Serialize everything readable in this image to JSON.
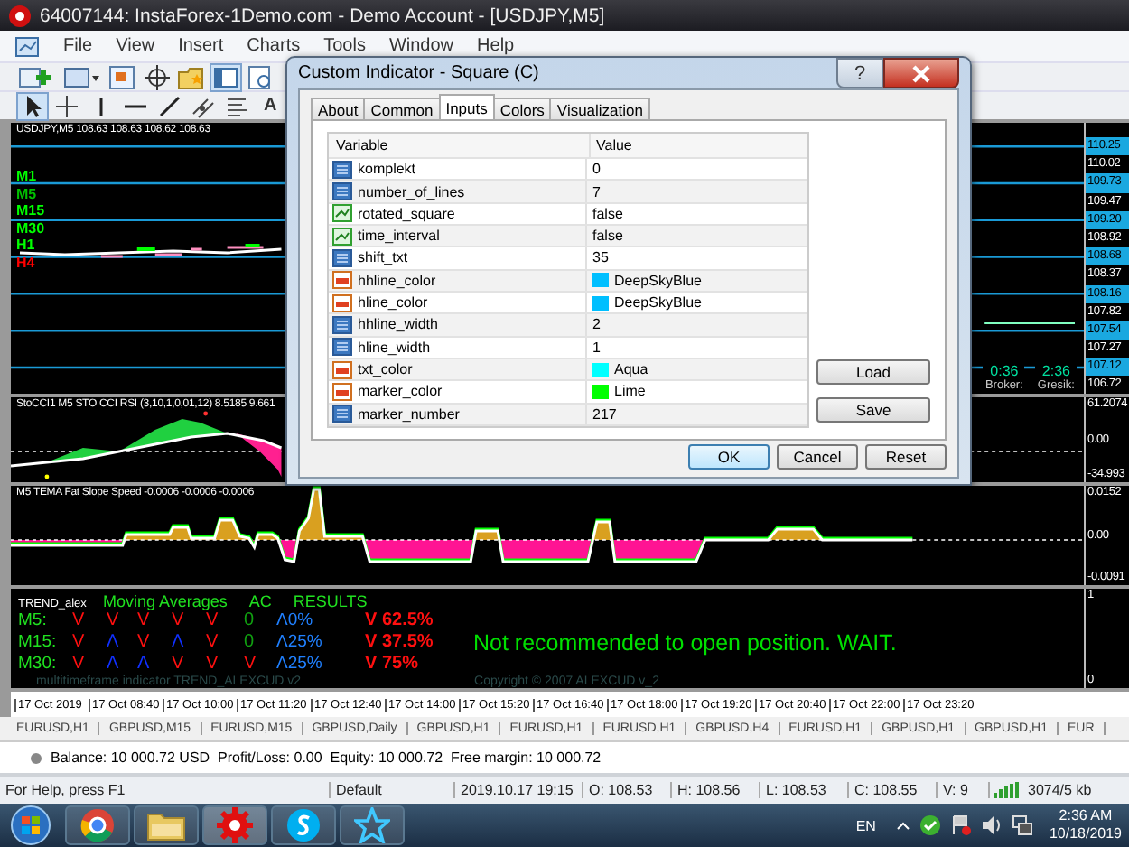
{
  "window": {
    "title": "64007144: InstaForex-1Demo.com - Demo Account - [USDJPY,M5]"
  },
  "menu": [
    "File",
    "View",
    "Insert",
    "Charts",
    "Tools",
    "Window",
    "Help"
  ],
  "drawing_tools": {
    "text_tool": "A"
  },
  "main_chart": {
    "header": "USDJPY,M5  108.63 108.63 108.62 108.63",
    "timeframes": [
      {
        "label": "M1",
        "color": "#00ff00"
      },
      {
        "label": "M5",
        "color": "#00c000"
      },
      {
        "label": "M15",
        "color": "#00ff00"
      },
      {
        "label": "M30",
        "color": "#00ff00"
      },
      {
        "label": "H1",
        "color": "#00ff00"
      },
      {
        "label": "H4",
        "color": "#ff0000"
      }
    ],
    "price_labels": [
      {
        "text": "110.25",
        "highlighted": true
      },
      {
        "text": "110.02",
        "highlighted": false
      },
      {
        "text": "109.73",
        "highlighted": true
      },
      {
        "text": "109.47",
        "highlighted": false
      },
      {
        "text": "109.20",
        "highlighted": true
      },
      {
        "text": "108.92",
        "highlighted": false
      },
      {
        "text": "108.68",
        "highlighted": true
      },
      {
        "text": "108.37",
        "highlighted": false
      },
      {
        "text": "108.16",
        "highlighted": true
      },
      {
        "text": "107.82",
        "highlighted": false
      },
      {
        "text": "107.54",
        "highlighted": true
      },
      {
        "text": "107.27",
        "highlighted": false
      },
      {
        "text": "107.12",
        "highlighted": true
      },
      {
        "text": "106.72",
        "highlighted": false
      }
    ],
    "clocks": [
      {
        "time": "0:36",
        "label": "Broker:"
      },
      {
        "time": "2:36",
        "label": "Gresik:"
      }
    ]
  },
  "oscillator": {
    "header": "StoCCI1 M5 STO CCI RSI (3,10,1,0,01,12) 8.5185 9.661",
    "scale": [
      "61.2074",
      "0.00",
      "-34.993"
    ]
  },
  "tema": {
    "header": "M5 TEMA Fat Slope Speed -0.0006 -0.0006 -0.0006",
    "scale": [
      "0.0152",
      "0.00",
      "-0.0091"
    ]
  },
  "trend_panel": {
    "title": "TREND_alex",
    "headings": [
      "Moving Averages",
      "AC",
      "RESULTS"
    ],
    "rows": [
      {
        "timeframe": "M5:",
        "signals": [
          {
            "text": "V",
            "kind": "down"
          },
          {
            "text": "V",
            "kind": "down"
          },
          {
            "text": "V",
            "kind": "down"
          },
          {
            "text": "V",
            "kind": "down"
          },
          {
            "text": "V",
            "kind": "down"
          },
          {
            "text": "0",
            "kind": "flat"
          },
          {
            "text": "Λ0%",
            "kind": "result"
          }
        ],
        "verdict": "V 62.5%"
      },
      {
        "timeframe": "M15:",
        "signals": [
          {
            "text": "V",
            "kind": "down"
          },
          {
            "text": "Λ",
            "kind": "up"
          },
          {
            "text": "V",
            "kind": "down"
          },
          {
            "text": "Λ",
            "kind": "up"
          },
          {
            "text": "V",
            "kind": "down"
          },
          {
            "text": "0",
            "kind": "flat"
          },
          {
            "text": "Λ25%",
            "kind": "result"
          }
        ],
        "verdict": "V 37.5%"
      },
      {
        "timeframe": "M30:",
        "signals": [
          {
            "text": "V",
            "kind": "down"
          },
          {
            "text": "Λ",
            "kind": "up"
          },
          {
            "text": "Λ",
            "kind": "up"
          },
          {
            "text": "V",
            "kind": "down"
          },
          {
            "text": "V",
            "kind": "down"
          },
          {
            "text": "V",
            "kind": "down"
          },
          {
            "text": "Λ25%",
            "kind": "result"
          }
        ],
        "verdict": "V 75%"
      }
    ],
    "message": "Not recommended to open position. WAIT.",
    "footer": "multitimeframe indicator TREND_ALEXCUD v2",
    "copyright": "Copyright © 2007 ALEXCUD v_2",
    "scale": [
      "1",
      "0"
    ]
  },
  "time_axis": [
    "17 Oct 2019",
    "17 Oct 08:40",
    "17 Oct 10:00",
    "17 Oct 11:20",
    "17 Oct 12:40",
    "17 Oct 14:00",
    "17 Oct 15:20",
    "17 Oct 16:40",
    "17 Oct 18:00",
    "17 Oct 19:20",
    "17 Oct 20:40",
    "17 Oct 22:00",
    "17 Oct 23:20"
  ],
  "symbol_tabs": [
    "EURUSD,H1",
    "GBPUSD,M15",
    "EURUSD,M15",
    "GBPUSD,Daily",
    "GBPUSD,H1",
    "EURUSD,H1",
    "EURUSD,H1",
    "GBPUSD,H4",
    "EURUSD,H1",
    "GBPUSD,H1",
    "GBPUSD,H1",
    "EUR"
  ],
  "account": "Balance: 10 000.72 USD  Profit/Loss: 0.00  Equity: 10 000.72  Free margin: 10 000.72",
  "status_bar": [
    "For Help, press F1",
    "Default",
    "2019.10.17 19:15",
    "O: 108.53",
    "H: 108.56",
    "L: 108.53",
    "C: 108.55",
    "V: 9",
    "3074/5 kb"
  ],
  "taskbar": {
    "language": "EN",
    "time": "2:36 AM",
    "date": "10/18/2019"
  },
  "dialog": {
    "title": "Custom Indicator - Square (C)",
    "help": "?",
    "tabs": [
      {
        "label": "About",
        "selected": false
      },
      {
        "label": "Common",
        "selected": false
      },
      {
        "label": "Inputs",
        "selected": true
      },
      {
        "label": "Colors",
        "selected": false
      },
      {
        "label": "Visualization",
        "selected": false
      }
    ],
    "columns": [
      "Variable",
      "Value"
    ],
    "rows": [
      {
        "name": "komplekt",
        "kind": "int",
        "value": "0"
      },
      {
        "name": "number_of_lines",
        "kind": "int",
        "value": "7"
      },
      {
        "name": "rotated_square",
        "kind": "bool",
        "value": "false"
      },
      {
        "name": "time_interval",
        "kind": "bool",
        "value": "false"
      },
      {
        "name": "shift_txt",
        "kind": "int",
        "value": "35"
      },
      {
        "name": "hhline_color",
        "kind": "color",
        "value": "DeepSkyBlue",
        "color": "#00bfff"
      },
      {
        "name": "hline_color",
        "kind": "color",
        "value": "DeepSkyBlue",
        "color": "#00bfff"
      },
      {
        "name": "hhline_width",
        "kind": "int",
        "value": "2"
      },
      {
        "name": "hline_width",
        "kind": "int",
        "value": "1"
      },
      {
        "name": "txt_color",
        "kind": "color",
        "value": "Aqua",
        "color": "#00ffff"
      },
      {
        "name": "marker_color",
        "kind": "color",
        "value": "Lime",
        "color": "#00ff00"
      },
      {
        "name": "marker_number",
        "kind": "int",
        "value": "217"
      }
    ],
    "side_buttons": [
      "Load",
      "Save"
    ],
    "buttons": [
      "OK",
      "Cancel",
      "Reset"
    ]
  }
}
